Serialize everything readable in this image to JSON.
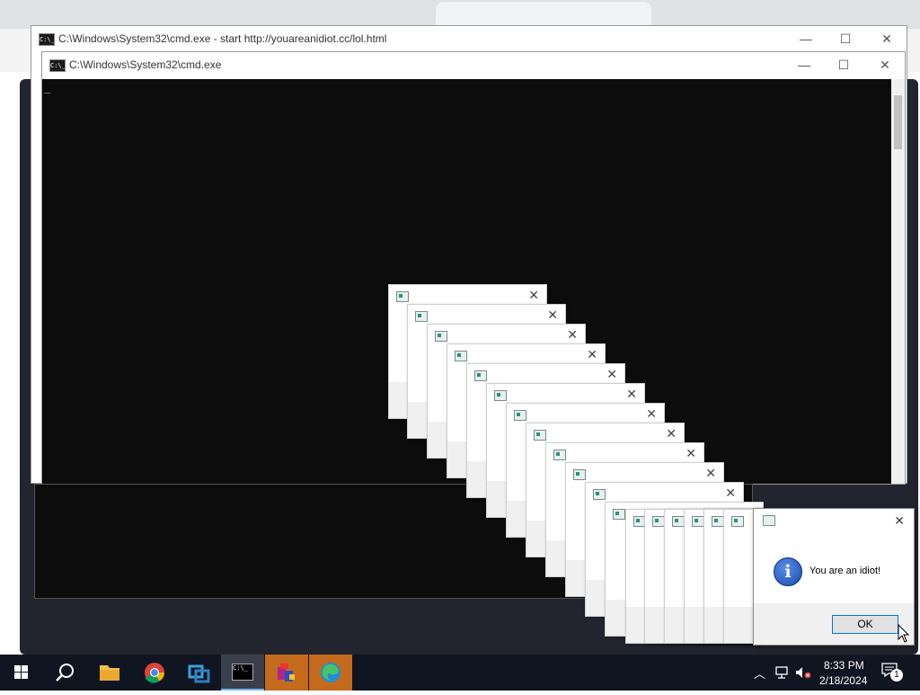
{
  "cmd_back": {
    "title": "C:\\Windows\\System32\\cmd.exe - start  http://youareanidiot.cc/lol.html"
  },
  "cmd_front": {
    "title": "C:\\Windows\\System32\\cmd.exe",
    "cursor": "_"
  },
  "window_controls": {
    "minimize": "—",
    "maximize": "☐",
    "close": "✕"
  },
  "popup_close_glyph": "✕",
  "dialog": {
    "message": "You are an idiot!",
    "ok_label": "OK",
    "close_glyph": "✕",
    "info_glyph": "i"
  },
  "taskbar": {
    "time": "8:33 PM",
    "date": "2/18/2024",
    "notification_count": "1",
    "cmd_icon_text": "C:\\_",
    "apps": [
      "start",
      "search",
      "file-explorer",
      "chrome",
      "virtualbox",
      "cmd",
      "winrar",
      "edge"
    ]
  },
  "colors": {
    "taskbar": "#101522",
    "console": "#0c0c0c",
    "accent": "#0078d7"
  }
}
